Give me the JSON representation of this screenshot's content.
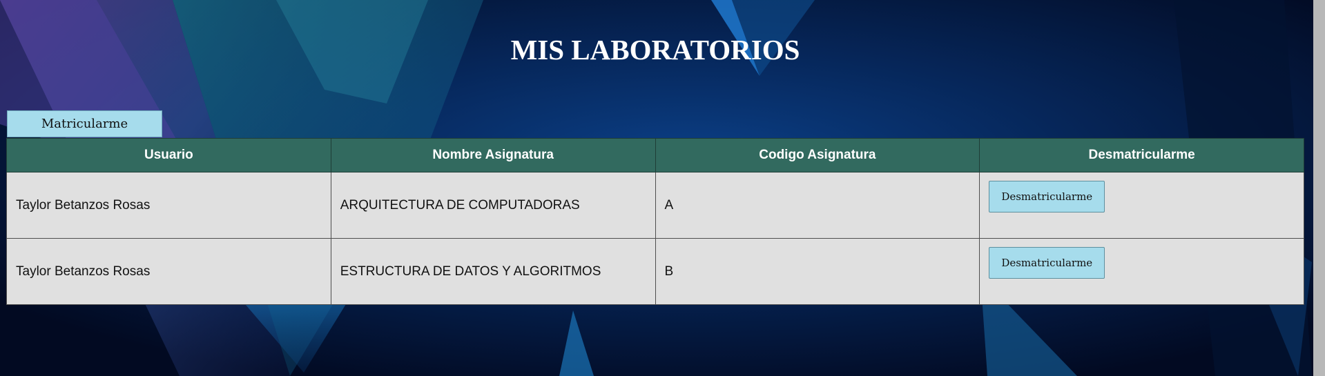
{
  "header": {
    "title": "MIS LABORATORIOS"
  },
  "toolbar": {
    "enroll_label": "Matricularme"
  },
  "table": {
    "columns": [
      "Usuario",
      "Nombre Asignatura",
      "Codigo Asignatura",
      "Desmatricularme"
    ],
    "rows": [
      {
        "usuario": "Taylor Betanzos Rosas",
        "nombre_asignatura": "ARQUITECTURA DE COMPUTADORAS",
        "codigo_asignatura": "A",
        "action_label": "Desmatricularme"
      },
      {
        "usuario": "Taylor Betanzos Rosas",
        "nombre_asignatura": "ESTRUCTURA DE DATOS Y ALGORITMOS",
        "codigo_asignatura": "B",
        "action_label": "Desmatricularme"
      }
    ]
  },
  "colors": {
    "header_row": "#326a5f",
    "button": "#a6dcec",
    "cell": "#e0e0e0",
    "background": "#03102e"
  }
}
